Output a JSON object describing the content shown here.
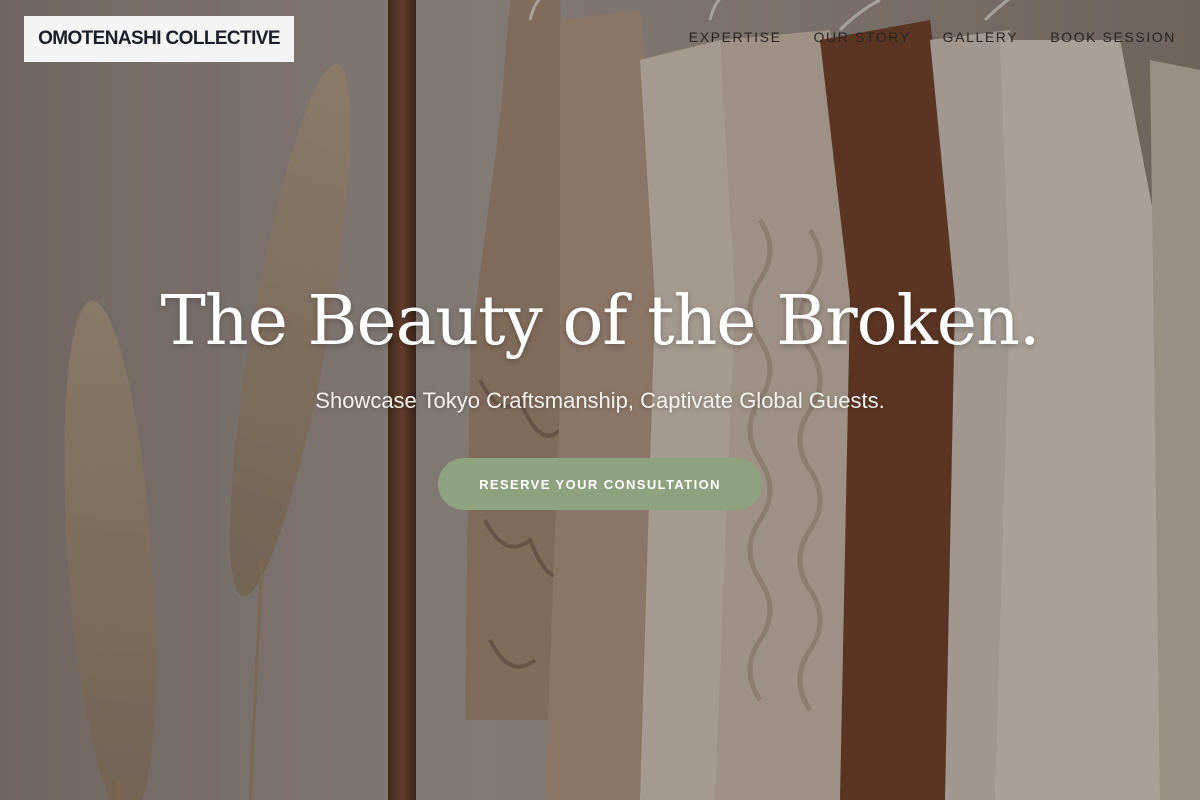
{
  "brand": {
    "logo_text": "OMOTENASHI COLLECTIVE"
  },
  "nav": {
    "items": [
      {
        "label": "EXPERTISE"
      },
      {
        "label": "OUR STORY"
      },
      {
        "label": "GALLERY"
      },
      {
        "label": "BOOK SESSION"
      }
    ]
  },
  "hero": {
    "headline": "The Beauty of the Broken.",
    "subtitle": "Showcase Tokyo Craftsmanship, Captivate Global Guests.",
    "cta_label": "RESERVE YOUR CONSULTATION",
    "background_description_icon": "clothing-rack-photo"
  },
  "colors": {
    "accent": "#8fa27f",
    "logo_bg": "#f4f4f5",
    "logo_text": "#1c1f2a",
    "nav_text": "#2a2523",
    "headline": "#ffffff"
  }
}
